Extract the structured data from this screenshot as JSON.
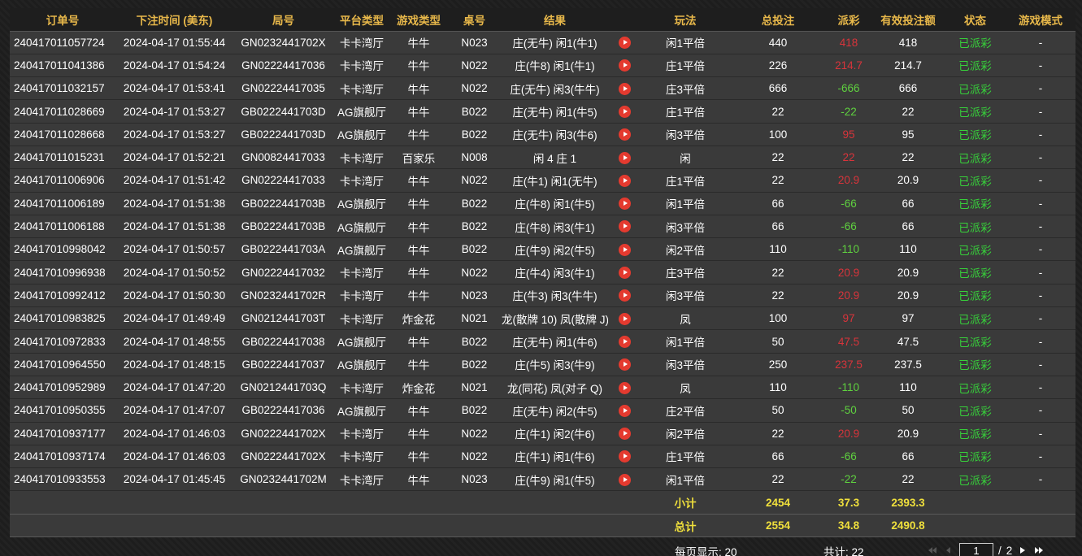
{
  "columns": [
    "订单号",
    "下注时间 (美东)",
    "局号",
    "平台类型",
    "游戏类型",
    "桌号",
    "结果",
    "",
    "玩法",
    "总投注",
    "派彩",
    "有效投注额",
    "状态",
    "游戏模式"
  ],
  "rows": [
    {
      "order": "240417011057724",
      "time": "2024-04-17 01:55:44",
      "round": "GN0232441702X",
      "platform": "卡卡湾厅",
      "game": "牛牛",
      "table": "N023",
      "result": "庄(无牛) 闲1(牛1)",
      "play": "闲1平倍",
      "bet": "440",
      "payout": "418",
      "payout_sign": "pos",
      "valid": "418",
      "status": "已派彩",
      "mode": "-"
    },
    {
      "order": "240417011041386",
      "time": "2024-04-17 01:54:24",
      "round": "GN02224417036",
      "platform": "卡卡湾厅",
      "game": "牛牛",
      "table": "N022",
      "result": "庄(牛8) 闲1(牛1)",
      "play": "庄1平倍",
      "bet": "226",
      "payout": "214.7",
      "payout_sign": "pos",
      "valid": "214.7",
      "status": "已派彩",
      "mode": "-"
    },
    {
      "order": "240417011032157",
      "time": "2024-04-17 01:53:41",
      "round": "GN02224417035",
      "platform": "卡卡湾厅",
      "game": "牛牛",
      "table": "N022",
      "result": "庄(无牛) 闲3(牛牛)",
      "play": "庄3平倍",
      "bet": "666",
      "payout": "-666",
      "payout_sign": "neg",
      "valid": "666",
      "status": "已派彩",
      "mode": "-"
    },
    {
      "order": "240417011028669",
      "time": "2024-04-17 01:53:27",
      "round": "GB0222441703D",
      "platform": "AG旗舰厅",
      "game": "牛牛",
      "table": "B022",
      "result": "庄(无牛) 闲1(牛5)",
      "play": "庄1平倍",
      "bet": "22",
      "payout": "-22",
      "payout_sign": "neg",
      "valid": "22",
      "status": "已派彩",
      "mode": "-"
    },
    {
      "order": "240417011028668",
      "time": "2024-04-17 01:53:27",
      "round": "GB0222441703D",
      "platform": "AG旗舰厅",
      "game": "牛牛",
      "table": "B022",
      "result": "庄(无牛) 闲3(牛6)",
      "play": "闲3平倍",
      "bet": "100",
      "payout": "95",
      "payout_sign": "pos",
      "valid": "95",
      "status": "已派彩",
      "mode": "-"
    },
    {
      "order": "240417011015231",
      "time": "2024-04-17 01:52:21",
      "round": "GN00824417033",
      "platform": "卡卡湾厅",
      "game": "百家乐",
      "table": "N008",
      "result": "闲 4 庄 1",
      "play": "闲",
      "bet": "22",
      "payout": "22",
      "payout_sign": "pos",
      "valid": "22",
      "status": "已派彩",
      "mode": "-"
    },
    {
      "order": "240417011006906",
      "time": "2024-04-17 01:51:42",
      "round": "GN02224417033",
      "platform": "卡卡湾厅",
      "game": "牛牛",
      "table": "N022",
      "result": "庄(牛1) 闲1(无牛)",
      "play": "庄1平倍",
      "bet": "22",
      "payout": "20.9",
      "payout_sign": "pos",
      "valid": "20.9",
      "status": "已派彩",
      "mode": "-"
    },
    {
      "order": "240417011006189",
      "time": "2024-04-17 01:51:38",
      "round": "GB0222441703B",
      "platform": "AG旗舰厅",
      "game": "牛牛",
      "table": "B022",
      "result": "庄(牛8) 闲1(牛5)",
      "play": "闲1平倍",
      "bet": "66",
      "payout": "-66",
      "payout_sign": "neg",
      "valid": "66",
      "status": "已派彩",
      "mode": "-"
    },
    {
      "order": "240417011006188",
      "time": "2024-04-17 01:51:38",
      "round": "GB0222441703B",
      "platform": "AG旗舰厅",
      "game": "牛牛",
      "table": "B022",
      "result": "庄(牛8) 闲3(牛1)",
      "play": "闲3平倍",
      "bet": "66",
      "payout": "-66",
      "payout_sign": "neg",
      "valid": "66",
      "status": "已派彩",
      "mode": "-"
    },
    {
      "order": "240417010998042",
      "time": "2024-04-17 01:50:57",
      "round": "GB0222441703A",
      "platform": "AG旗舰厅",
      "game": "牛牛",
      "table": "B022",
      "result": "庄(牛9) 闲2(牛5)",
      "play": "闲2平倍",
      "bet": "110",
      "payout": "-110",
      "payout_sign": "neg",
      "valid": "110",
      "status": "已派彩",
      "mode": "-"
    },
    {
      "order": "240417010996938",
      "time": "2024-04-17 01:50:52",
      "round": "GN02224417032",
      "platform": "卡卡湾厅",
      "game": "牛牛",
      "table": "N022",
      "result": "庄(牛4) 闲3(牛1)",
      "play": "庄3平倍",
      "bet": "22",
      "payout": "20.9",
      "payout_sign": "pos",
      "valid": "20.9",
      "status": "已派彩",
      "mode": "-"
    },
    {
      "order": "240417010992412",
      "time": "2024-04-17 01:50:30",
      "round": "GN0232441702R",
      "platform": "卡卡湾厅",
      "game": "牛牛",
      "table": "N023",
      "result": "庄(牛3) 闲3(牛牛)",
      "play": "闲3平倍",
      "bet": "22",
      "payout": "20.9",
      "payout_sign": "pos",
      "valid": "20.9",
      "status": "已派彩",
      "mode": "-"
    },
    {
      "order": "240417010983825",
      "time": "2024-04-17 01:49:49",
      "round": "GN0212441703T",
      "platform": "卡卡湾厅",
      "game": "炸金花",
      "table": "N021",
      "result": "龙(散牌 10) 凤(散牌 J)",
      "play": "凤",
      "bet": "100",
      "payout": "97",
      "payout_sign": "pos",
      "valid": "97",
      "status": "已派彩",
      "mode": "-"
    },
    {
      "order": "240417010972833",
      "time": "2024-04-17 01:48:55",
      "round": "GB02224417038",
      "platform": "AG旗舰厅",
      "game": "牛牛",
      "table": "B022",
      "result": "庄(无牛) 闲1(牛6)",
      "play": "闲1平倍",
      "bet": "50",
      "payout": "47.5",
      "payout_sign": "pos",
      "valid": "47.5",
      "status": "已派彩",
      "mode": "-"
    },
    {
      "order": "240417010964550",
      "time": "2024-04-17 01:48:15",
      "round": "GB02224417037",
      "platform": "AG旗舰厅",
      "game": "牛牛",
      "table": "B022",
      "result": "庄(牛5) 闲3(牛9)",
      "play": "闲3平倍",
      "bet": "250",
      "payout": "237.5",
      "payout_sign": "pos",
      "valid": "237.5",
      "status": "已派彩",
      "mode": "-"
    },
    {
      "order": "240417010952989",
      "time": "2024-04-17 01:47:20",
      "round": "GN0212441703Q",
      "platform": "卡卡湾厅",
      "game": "炸金花",
      "table": "N021",
      "result": "龙(同花) 凤(对子 Q)",
      "play": "凤",
      "bet": "110",
      "payout": "-110",
      "payout_sign": "neg",
      "valid": "110",
      "status": "已派彩",
      "mode": "-"
    },
    {
      "order": "240417010950355",
      "time": "2024-04-17 01:47:07",
      "round": "GB02224417036",
      "platform": "AG旗舰厅",
      "game": "牛牛",
      "table": "B022",
      "result": "庄(无牛) 闲2(牛5)",
      "play": "庄2平倍",
      "bet": "50",
      "payout": "-50",
      "payout_sign": "neg",
      "valid": "50",
      "status": "已派彩",
      "mode": "-"
    },
    {
      "order": "240417010937177",
      "time": "2024-04-17 01:46:03",
      "round": "GN0222441702X",
      "platform": "卡卡湾厅",
      "game": "牛牛",
      "table": "N022",
      "result": "庄(牛1) 闲2(牛6)",
      "play": "闲2平倍",
      "bet": "22",
      "payout": "20.9",
      "payout_sign": "pos",
      "valid": "20.9",
      "status": "已派彩",
      "mode": "-"
    },
    {
      "order": "240417010937174",
      "time": "2024-04-17 01:46:03",
      "round": "GN0222441702X",
      "platform": "卡卡湾厅",
      "game": "牛牛",
      "table": "N022",
      "result": "庄(牛1) 闲1(牛6)",
      "play": "庄1平倍",
      "bet": "66",
      "payout": "-66",
      "payout_sign": "neg",
      "valid": "66",
      "status": "已派彩",
      "mode": "-"
    },
    {
      "order": "240417010933553",
      "time": "2024-04-17 01:45:45",
      "round": "GN0232441702M",
      "platform": "卡卡湾厅",
      "game": "牛牛",
      "table": "N023",
      "result": "庄(牛9) 闲1(牛5)",
      "play": "闲1平倍",
      "bet": "22",
      "payout": "-22",
      "payout_sign": "neg",
      "valid": "22",
      "status": "已派彩",
      "mode": "-"
    }
  ],
  "subtotal": {
    "label": "小计",
    "bet": "2454",
    "payout": "37.3",
    "valid": "2393.3"
  },
  "total": {
    "label": "总计",
    "bet": "2554",
    "payout": "34.8",
    "valid": "2490.8"
  },
  "pager": {
    "per_page": "每页显示: 20",
    "total": "共计: 22",
    "current_page": "1",
    "separator": "/",
    "total_pages": "2"
  },
  "colors": {
    "header_text": "#e8b84a",
    "footer_text": "#f0e03c",
    "negative": "#5fd13f",
    "positive": "#d8343b",
    "status": "#37d13a",
    "play_icon": "#e43a2f"
  },
  "icons": {
    "replay": "play-circle-icon",
    "first": "first-page-icon",
    "prev": "prev-page-icon",
    "next": "next-page-icon",
    "last": "last-page-icon"
  }
}
